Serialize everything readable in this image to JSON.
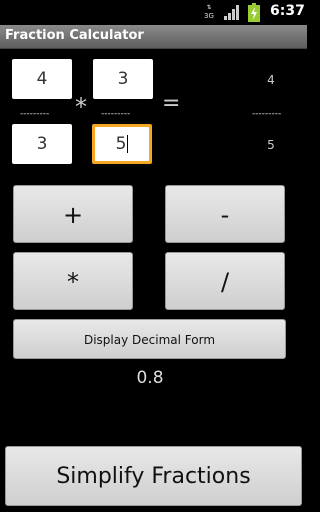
{
  "status_bar": {
    "network_type": "3G",
    "signal_icon": "signal-icon",
    "battery_icon": "battery-charging-icon",
    "time": "6:37"
  },
  "app": {
    "title": "Fraction Calculator"
  },
  "calculator": {
    "fraction1": {
      "numerator": "4",
      "denominator": "3"
    },
    "fraction2": {
      "numerator": "3",
      "denominator": "5"
    },
    "operator_symbol": "*",
    "equals_symbol": "=",
    "divider": "---------",
    "result": {
      "numerator": "4",
      "denominator": "5"
    }
  },
  "buttons": {
    "add": "+",
    "subtract": "-",
    "multiply": "*",
    "divide": "/",
    "display_decimal": "Display Decimal Form",
    "simplify": "Simplify Fractions"
  },
  "decimal_result": "0.8"
}
